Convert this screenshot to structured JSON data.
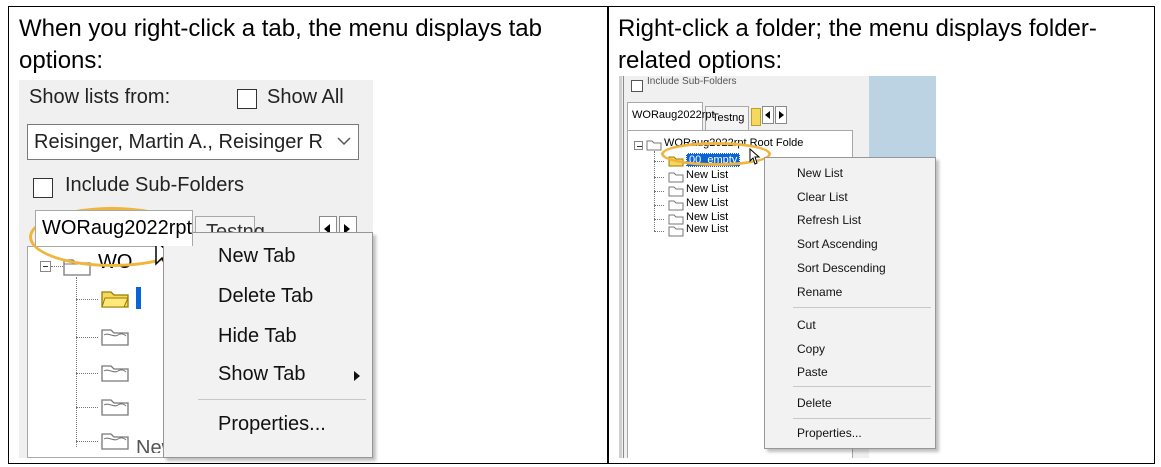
{
  "captions": {
    "left": "When you right-click a tab, the menu displays tab options:",
    "right": "Right-click a folder; the menu displays folder-related options:"
  },
  "left_screenshot": {
    "show_lists_label": "Show lists from:",
    "show_all_label": "Show All",
    "owner_select_value": "Reisinger, Martin A., Reisinger Resc",
    "include_subfolders_label": "Include Sub-Folders",
    "tabs": [
      "WORaug2022rpt",
      "Testng"
    ],
    "tree_root_label": "WO",
    "tree_partial_label": "New List",
    "context_menu": {
      "items": [
        "New Tab",
        "Delete Tab",
        "Hide Tab",
        "Show Tab",
        "Properties..."
      ]
    },
    "highlight_color": "#f0b53a"
  },
  "right_screenshot": {
    "top_label": "Include Sub-Folders",
    "tabs": [
      "WORaug2022rpt",
      "Testng"
    ],
    "tree": {
      "root_label": "WORaug2022rpt Root Folde",
      "selected_label": "00_empty",
      "children": [
        "New List",
        "New List",
        "New List",
        "New List",
        "New List"
      ]
    },
    "context_menu": {
      "group1": [
        "New List",
        "Clear List",
        "Refresh List",
        "Sort Ascending",
        "Sort Descending",
        "Rename"
      ],
      "group2": [
        "Cut",
        "Copy",
        "Paste"
      ],
      "group3": [
        "Delete"
      ],
      "group4": [
        "Properties..."
      ]
    },
    "selection_color": "#0a64d8"
  }
}
